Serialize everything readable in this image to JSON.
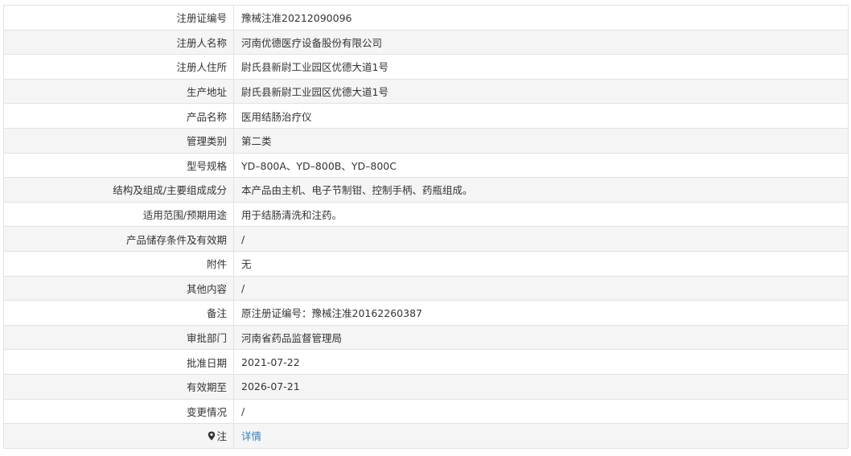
{
  "rows": [
    {
      "label": "注册证编号",
      "value": "豫械注准20212090096"
    },
    {
      "label": "注册人名称",
      "value": "河南优德医疗设备股份有限公司"
    },
    {
      "label": "注册人住所",
      "value": "尉氏县新尉工业园区优德大道1号"
    },
    {
      "label": "生产地址",
      "value": "尉氏县新尉工业园区优德大道1号"
    },
    {
      "label": "产品名称",
      "value": "医用结肠治疗仪"
    },
    {
      "label": "管理类别",
      "value": "第二类"
    },
    {
      "label": "型号规格",
      "value": "YD–800A、YD–800B、YD–800C"
    },
    {
      "label": "结构及组成/主要组成成分",
      "value": "本产品由主机、电子节制钳、控制手柄、药瓶组成。"
    },
    {
      "label": "适用范围/预期用途",
      "value": "用于结肠清洗和注药。"
    },
    {
      "label": "产品储存条件及有效期",
      "value": "/"
    },
    {
      "label": "附件",
      "value": "无"
    },
    {
      "label": "其他内容",
      "value": "/"
    },
    {
      "label": "备注",
      "value": "原注册证编号：豫械注准20162260387"
    },
    {
      "label": "审批部门",
      "value": "河南省药品监督管理局"
    },
    {
      "label": "批准日期",
      "value": "2021-07-22"
    },
    {
      "label": "有效期至",
      "value": "2026-07-21"
    },
    {
      "label": "变更情况",
      "value": "/"
    }
  ],
  "note_row": {
    "label": "注",
    "link_text": "详情",
    "icon": "map-pin-icon"
  },
  "colors": {
    "border": "#e2e2e2",
    "stripe": "#f5f5f5",
    "text": "#333333",
    "link": "#2f7fc1"
  }
}
